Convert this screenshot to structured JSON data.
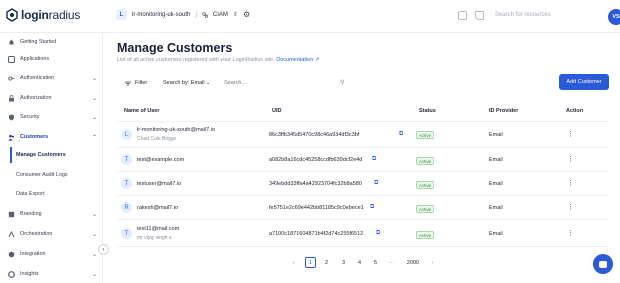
{
  "brand": {
    "logo_bold": "login",
    "logo_light": "radius"
  },
  "environment": {
    "badge": "L",
    "name": "lr-monitoring-uk-south",
    "separator": "|",
    "type": "CIAM"
  },
  "top": {
    "search_placeholder": "Search for resources",
    "avatar": "VS"
  },
  "sidebar": {
    "items": [
      {
        "label": "Getting Started",
        "icon": "rocket-icon"
      },
      {
        "label": "Applications",
        "icon": "apps-icon"
      },
      {
        "label": "Authentication",
        "icon": "key-icon"
      },
      {
        "label": "Authorization",
        "icon": "lock-icon"
      },
      {
        "label": "Security",
        "icon": "shield-icon"
      },
      {
        "label": "Customers",
        "icon": "users-icon"
      },
      {
        "label": "Branding",
        "icon": "palette-icon"
      },
      {
        "label": "Orchestration",
        "icon": "flow-icon"
      },
      {
        "label": "Integration",
        "icon": "plug-icon"
      },
      {
        "label": "Insights",
        "icon": "chart-icon"
      }
    ],
    "sub_items": [
      {
        "label": "Manage Customers"
      },
      {
        "label": "Consumer Audit Logs"
      },
      {
        "label": "Data Export"
      }
    ],
    "collapse_glyph": "‹"
  },
  "main": {
    "title": "Manage Customers",
    "subtitle": "List of all active customers registered with your LoginRadius site.",
    "doc_link": "Documentation",
    "filter_label": "Filter",
    "search_by": "Search by: Email",
    "search_placeholder": "Search...",
    "add_button": "Add Customer"
  },
  "table": {
    "headers": [
      "Name of User",
      "UID",
      "Status",
      "ID Provider",
      "Action"
    ],
    "rows": [
      {
        "initial": "L",
        "name": "lr-monitoring-uk-south@mail7.io",
        "subname": "Chad Cole Briggs",
        "uid": "86c3ffb345d5470c98c46a934df3c3bf",
        "status": "Active",
        "provider": "Email"
      },
      {
        "initial": "T",
        "name": "test@example.com",
        "subname": "",
        "uid": "a082b8a16cdc45258ccdfb639dcf2e4d",
        "status": "Active",
        "provider": "Email"
      },
      {
        "initial": "T",
        "name": "testuser@mail7.io",
        "subname": "",
        "uid": "349ebdd33ffa4a42923704fc32b8a580",
        "status": "Active",
        "provider": "Email"
      },
      {
        "initial": "R",
        "name": "rakesh@mail7.io",
        "subname": "",
        "uid": "fe5751e2c69e442bb81185c9c0ebece1",
        "status": "Active",
        "provider": "Email"
      },
      {
        "initial": "T",
        "name": "test11@mail.com",
        "subname": "mr vijay singh s",
        "uid": "a7100c1871604871b4f2d74c255f6512",
        "status": "Active",
        "provider": "Email"
      }
    ]
  },
  "pagination": {
    "pages": [
      "1",
      "2",
      "3",
      "4",
      "5"
    ],
    "ellipsis": "···",
    "last": "2000",
    "current": "1"
  },
  "colors": {
    "accent": "#2a5ad8",
    "active_status": "#2f8a34"
  }
}
